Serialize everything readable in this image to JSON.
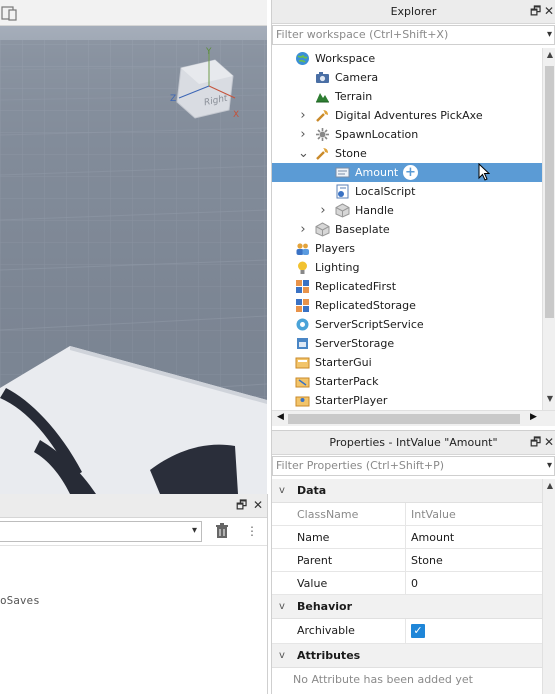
{
  "viewport": {
    "gizmo_labels": {
      "y": "Y",
      "x": "X",
      "z": "Z",
      "face": "Right"
    }
  },
  "output_panel": {
    "filter_value": "",
    "visible_text": "oSaves"
  },
  "explorer": {
    "title": "Explorer",
    "filter_placeholder": "Filter workspace (Ctrl+Shift+X)",
    "items": [
      {
        "label": "Workspace",
        "icon": "workspace-globe-icon",
        "depth": 0,
        "expander": ""
      },
      {
        "label": "Camera",
        "icon": "camera-icon",
        "depth": 1,
        "expander": ""
      },
      {
        "label": "Terrain",
        "icon": "terrain-icon",
        "depth": 1,
        "expander": ""
      },
      {
        "label": "Digital Adventures PickAxe",
        "icon": "tool-icon",
        "depth": 1,
        "expander": ">"
      },
      {
        "label": "SpawnLocation",
        "icon": "spawn-icon",
        "depth": 1,
        "expander": ">"
      },
      {
        "label": "Stone",
        "icon": "tool-icon",
        "depth": 1,
        "expander": "v"
      },
      {
        "label": "Amount",
        "icon": "intvalue-icon",
        "depth": 2,
        "expander": "",
        "selected": true,
        "add_button": "+"
      },
      {
        "label": "LocalScript",
        "icon": "localscript-icon",
        "depth": 2,
        "expander": ""
      },
      {
        "label": "Handle",
        "icon": "part-icon",
        "depth": 2,
        "expander": ">"
      },
      {
        "label": "Baseplate",
        "icon": "part-icon",
        "depth": 1,
        "expander": ">"
      },
      {
        "label": "Players",
        "icon": "players-icon",
        "depth": 0,
        "expander": ""
      },
      {
        "label": "Lighting",
        "icon": "lighting-icon",
        "depth": 0,
        "expander": ""
      },
      {
        "label": "ReplicatedFirst",
        "icon": "replicated-first-icon",
        "depth": 0,
        "expander": ""
      },
      {
        "label": "ReplicatedStorage",
        "icon": "replicated-storage-icon",
        "depth": 0,
        "expander": ""
      },
      {
        "label": "ServerScriptService",
        "icon": "server-script-service-icon",
        "depth": 0,
        "expander": ""
      },
      {
        "label": "ServerStorage",
        "icon": "server-storage-icon",
        "depth": 0,
        "expander": ""
      },
      {
        "label": "StarterGui",
        "icon": "starter-gui-icon",
        "depth": 0,
        "expander": ""
      },
      {
        "label": "StarterPack",
        "icon": "starter-pack-icon",
        "depth": 0,
        "expander": ""
      },
      {
        "label": "StarterPlayer",
        "icon": "starter-player-icon",
        "depth": 0,
        "expander": ""
      }
    ]
  },
  "properties": {
    "title": "Properties - IntValue \"Amount\"",
    "filter_placeholder": "Filter Properties (Ctrl+Shift+P)",
    "sections": {
      "data": {
        "title": "Data",
        "rows": [
          {
            "key": "ClassName",
            "value": "IntValue",
            "readonly": true
          },
          {
            "key": "Name",
            "value": "Amount",
            "readonly": false
          },
          {
            "key": "Parent",
            "value": "Stone",
            "readonly": false
          },
          {
            "key": "Value",
            "value": "0",
            "readonly": false
          }
        ]
      },
      "behavior": {
        "title": "Behavior",
        "archivable_label": "Archivable",
        "archivable_checked": true
      },
      "attributes": {
        "title": "Attributes",
        "empty_text": "No Attribute has been added yet"
      }
    }
  },
  "colors": {
    "selection": "#5b9bd5",
    "checkbox": "#1f86d8",
    "panel_header": "#ececec"
  }
}
